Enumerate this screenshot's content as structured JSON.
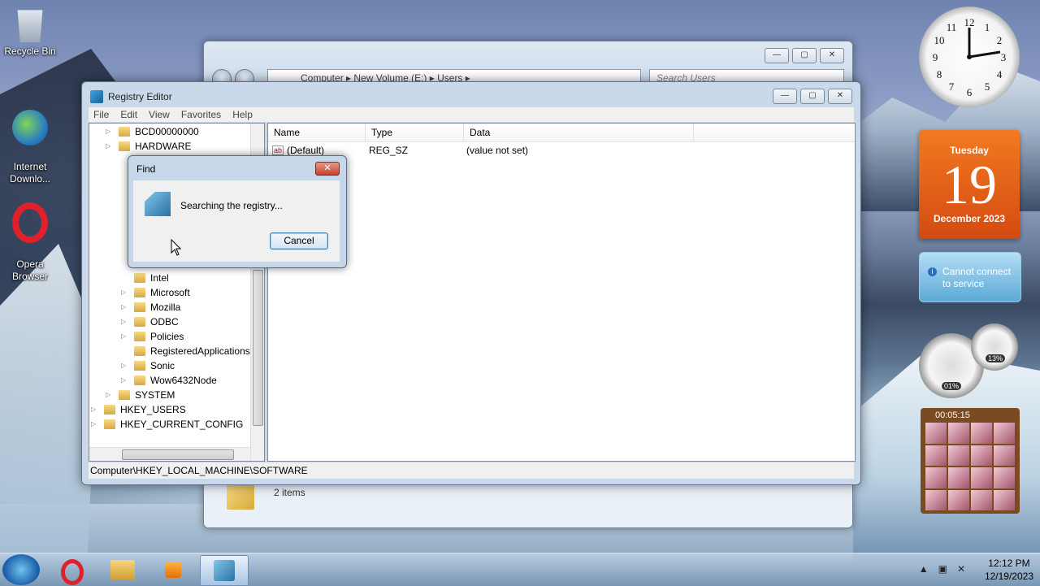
{
  "desktop": {
    "icons": [
      {
        "label": "Recycle Bin"
      },
      {
        "label": "Internet\nDownlo..."
      },
      {
        "label": "Opera\nBrowser"
      }
    ]
  },
  "explorer": {
    "address": "Computer  ▸  New Volume (E:)  ▸  Users  ▸",
    "search_placeholder": "Search Users",
    "item_count": "2 items"
  },
  "regedit": {
    "title": "Registry Editor",
    "menu": [
      "File",
      "Edit",
      "View",
      "Favorites",
      "Help"
    ],
    "tree": [
      {
        "label": "BCD00000000",
        "level": 1,
        "expandable": true
      },
      {
        "label": "HARDWARE",
        "level": 1,
        "expandable": true
      },
      {
        "label": "Intel",
        "level": 2,
        "expandable": false
      },
      {
        "label": "Microsoft",
        "level": 2,
        "expandable": true
      },
      {
        "label": "Mozilla",
        "level": 2,
        "expandable": true
      },
      {
        "label": "ODBC",
        "level": 2,
        "expandable": true
      },
      {
        "label": "Policies",
        "level": 2,
        "expandable": true
      },
      {
        "label": "RegisteredApplications",
        "level": 2,
        "expandable": false
      },
      {
        "label": "Sonic",
        "level": 2,
        "expandable": true
      },
      {
        "label": "Wow6432Node",
        "level": 2,
        "expandable": true
      },
      {
        "label": "SYSTEM",
        "level": 1,
        "expandable": true
      },
      {
        "label": "HKEY_USERS",
        "level": 0,
        "expandable": true
      },
      {
        "label": "HKEY_CURRENT_CONFIG",
        "level": 0,
        "expandable": true
      }
    ],
    "columns": [
      "Name",
      "Type",
      "Data"
    ],
    "values": [
      {
        "name": "(Default)",
        "type": "REG_SZ",
        "data": "(value not set)"
      }
    ],
    "status_path": "Computer\\HKEY_LOCAL_MACHINE\\SOFTWARE"
  },
  "find_dialog": {
    "title": "Find",
    "message": "Searching the registry...",
    "cancel_label": "Cancel",
    "close_label": "✕"
  },
  "gadgets": {
    "calendar": {
      "weekday": "Tuesday",
      "day": "19",
      "month_year": "December 2023"
    },
    "weather": {
      "message": "Cannot connect\nto service"
    },
    "cpu_meter": {
      "cpu": "01%",
      "memory": "13%"
    },
    "puzzle": {
      "time": "00:05:15"
    }
  },
  "taskbar": {
    "time": "12:12 PM",
    "date": "12/19/2023"
  }
}
